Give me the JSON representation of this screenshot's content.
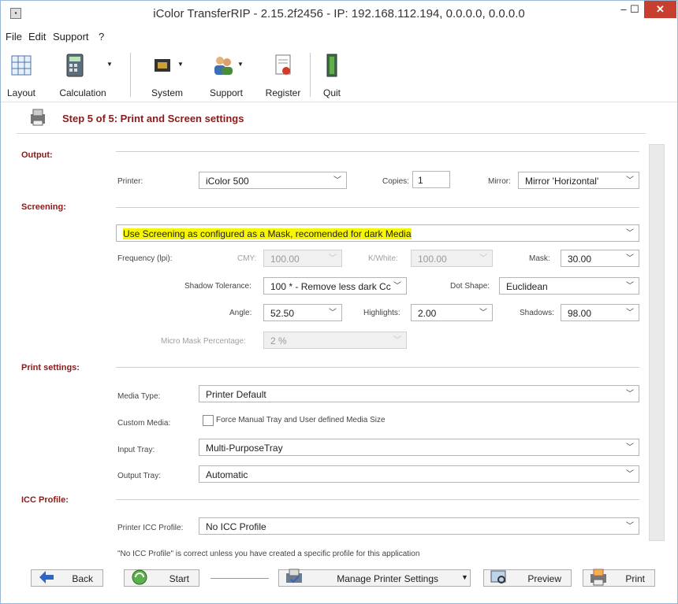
{
  "window": {
    "title": "iColor TransferRIP - 2.15.2f2456 - IP: 192.168.112.194, 0.0.0.0, 0.0.0.0",
    "minimize": "–",
    "maximize": "☐",
    "close": "✕"
  },
  "menu": [
    "File",
    "Edit",
    "Support",
    "?"
  ],
  "toolbar": {
    "layout": "Layout",
    "calculation": "Calculation",
    "system": "System",
    "support": "Support",
    "register": "Register",
    "quit": "Quit"
  },
  "step": "Step 5 of 5: Print and Screen settings",
  "output": {
    "section": "Output:",
    "printer_label": "Printer:",
    "printer_value": "iColor 500",
    "copies_label": "Copies:",
    "copies_value": "1",
    "mirror_label": "Mirror:",
    "mirror_value": "Mirror 'Horizontal'"
  },
  "screening": {
    "section": "Screening:",
    "mode_value": "Use Screening as configured as a Mask, recomended for dark Media",
    "frequency_label": "Frequency (lpi):",
    "cmy_label": "CMY:",
    "cmy_value": "100.00",
    "kwhite_label": "K/White:",
    "kwhite_value": "100.00",
    "mask_label": "Mask:",
    "mask_value": "30.00",
    "shadow_tol_label": "Shadow Tolerance:",
    "shadow_tol_value": "100 * - Remove less dark Cc",
    "dot_shape_label": "Dot Shape:",
    "dot_shape_value": "Euclidean",
    "angle_label": "Angle:",
    "angle_value": "52.50",
    "highlights_label": "Highlights:",
    "highlights_value": "2.00",
    "shadows_label": "Shadows:",
    "shadows_value": "98.00",
    "micro_mask_label": "Micro Mask Percentage:",
    "micro_mask_value": "2 %"
  },
  "print_settings": {
    "section": "Print settings:",
    "media_type_label": "Media Type:",
    "media_type_value": "Printer Default",
    "custom_media_label": "Custom Media:",
    "custom_media_checkbox": "Force Manual Tray and User defined Media Size",
    "input_tray_label": "Input Tray:",
    "input_tray_value": "Multi-PurposeTray",
    "output_tray_label": "Output Tray:",
    "output_tray_value": "Automatic"
  },
  "icc": {
    "section": "ICC Profile:",
    "printer_icc_label": "Printer ICC Profile:",
    "printer_icc_value": "No ICC Profile",
    "note": "\"No ICC Profile\" is correct unless you have created a specific profile for this application"
  },
  "buttons": {
    "back": "Back",
    "start": "Start",
    "manage": "Manage Printer Settings",
    "preview": "Preview",
    "print": "Print"
  },
  "colors": {
    "accent": "#8a1a1a",
    "close": "#c7402f",
    "highlight": "#f6f600"
  }
}
